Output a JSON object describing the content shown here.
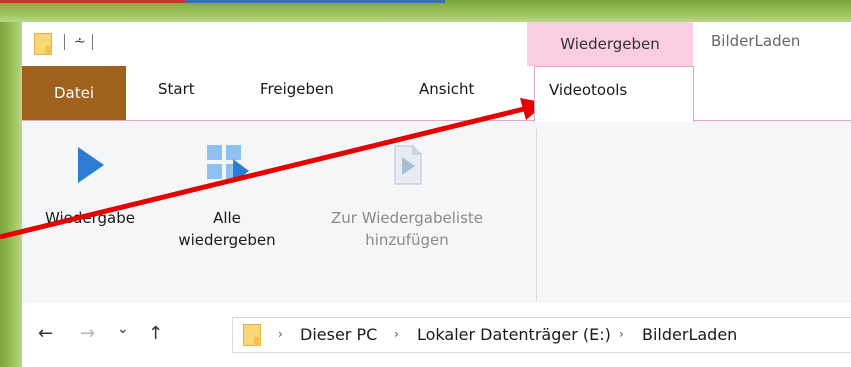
{
  "qat": {
    "dropdown_glyph": "⩪"
  },
  "context_tabs": {
    "group_label": "Wiedergeben",
    "window_title": "BilderLaden"
  },
  "tabs": {
    "file": "Datei",
    "start": "Start",
    "share": "Freigeben",
    "view": "Ansicht",
    "videotools": "Videotools"
  },
  "ribbon": {
    "play": {
      "label": "Wiedergabe"
    },
    "play_all": {
      "label_line1": "Alle",
      "label_line2": "wiedergeben"
    },
    "add_to_playlist": {
      "label_line1": "Zur Wiedergabeliste",
      "label_line2": "hinzufügen"
    }
  },
  "address": {
    "back": "←",
    "forward": "→",
    "recent": "⌄",
    "up": "↑",
    "crumbs": [
      "Dieser PC",
      "Lokaler Datenträger (E:)",
      "BilderLaden"
    ],
    "separator": "›"
  },
  "colors": {
    "accent_file_tab": "#a0611c",
    "context_pink": "#fbcde3",
    "play_blue": "#2b7cd3",
    "annotation_red": "#e60000",
    "frame_green": "#8bb74a"
  }
}
